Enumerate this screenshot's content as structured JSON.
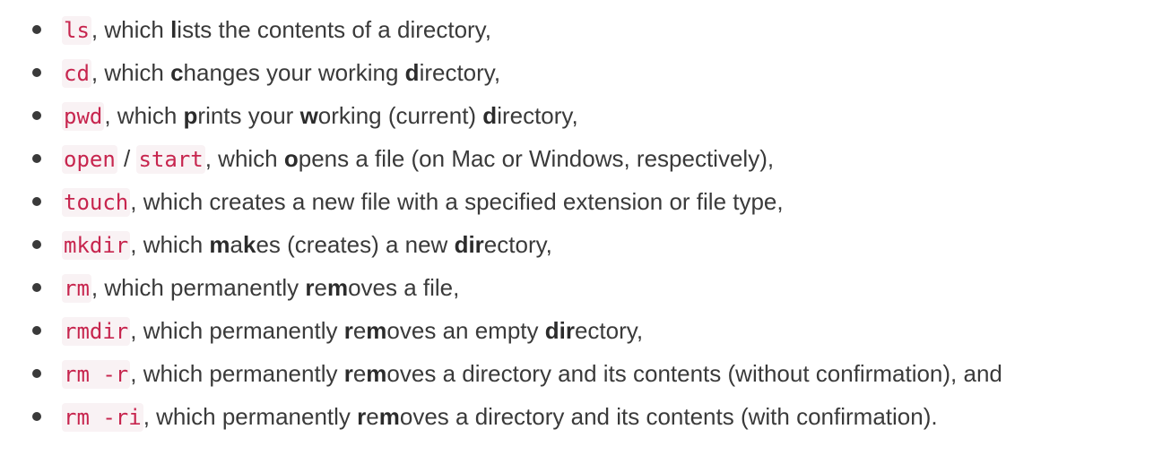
{
  "items": [
    {
      "commands": [
        "ls"
      ],
      "segments": [
        {
          "text": ", which ",
          "bold": false
        },
        {
          "text": "l",
          "bold": true
        },
        {
          "text": "ists the contents of a directory,",
          "bold": false
        }
      ]
    },
    {
      "commands": [
        "cd"
      ],
      "segments": [
        {
          "text": ", which ",
          "bold": false
        },
        {
          "text": "c",
          "bold": true
        },
        {
          "text": "hanges your working ",
          "bold": false
        },
        {
          "text": "d",
          "bold": true
        },
        {
          "text": "irectory,",
          "bold": false
        }
      ]
    },
    {
      "commands": [
        "pwd"
      ],
      "segments": [
        {
          "text": ", which ",
          "bold": false
        },
        {
          "text": "p",
          "bold": true
        },
        {
          "text": "rints your ",
          "bold": false
        },
        {
          "text": "w",
          "bold": true
        },
        {
          "text": "orking (current) ",
          "bold": false
        },
        {
          "text": "d",
          "bold": true
        },
        {
          "text": "irectory,",
          "bold": false
        }
      ]
    },
    {
      "commands": [
        "open",
        "start"
      ],
      "separator": " / ",
      "segments": [
        {
          "text": ", which ",
          "bold": false
        },
        {
          "text": "o",
          "bold": true
        },
        {
          "text": "pens a file (on Mac or Windows, respectively),",
          "bold": false
        }
      ]
    },
    {
      "commands": [
        "touch"
      ],
      "segments": [
        {
          "text": ", which creates a new file with a specified extension or file type,",
          "bold": false
        }
      ]
    },
    {
      "commands": [
        "mkdir"
      ],
      "segments": [
        {
          "text": ", which ",
          "bold": false
        },
        {
          "text": "m",
          "bold": true
        },
        {
          "text": "a",
          "bold": false
        },
        {
          "text": "k",
          "bold": true
        },
        {
          "text": "es (creates) a new ",
          "bold": false
        },
        {
          "text": "dir",
          "bold": true
        },
        {
          "text": "ectory,",
          "bold": false
        }
      ]
    },
    {
      "commands": [
        "rm"
      ],
      "segments": [
        {
          "text": ", which permanently ",
          "bold": false
        },
        {
          "text": "r",
          "bold": true
        },
        {
          "text": "e",
          "bold": false
        },
        {
          "text": "m",
          "bold": true
        },
        {
          "text": "oves a file,",
          "bold": false
        }
      ]
    },
    {
      "commands": [
        "rmdir"
      ],
      "segments": [
        {
          "text": ", which permanently ",
          "bold": false
        },
        {
          "text": "r",
          "bold": true
        },
        {
          "text": "e",
          "bold": false
        },
        {
          "text": "m",
          "bold": true
        },
        {
          "text": "oves an empty ",
          "bold": false
        },
        {
          "text": "dir",
          "bold": true
        },
        {
          "text": "ectory,",
          "bold": false
        }
      ]
    },
    {
      "commands": [
        "rm -r"
      ],
      "segments": [
        {
          "text": ", which permanently ",
          "bold": false
        },
        {
          "text": "r",
          "bold": true
        },
        {
          "text": "e",
          "bold": false
        },
        {
          "text": "m",
          "bold": true
        },
        {
          "text": "oves a directory and its contents (without confirmation), and",
          "bold": false
        }
      ]
    },
    {
      "commands": [
        "rm -ri"
      ],
      "segments": [
        {
          "text": ", which permanently ",
          "bold": false
        },
        {
          "text": "r",
          "bold": true
        },
        {
          "text": "e",
          "bold": false
        },
        {
          "text": "m",
          "bold": true
        },
        {
          "text": "oves a directory and its contents (with confirmation).",
          "bold": false
        }
      ]
    }
  ]
}
